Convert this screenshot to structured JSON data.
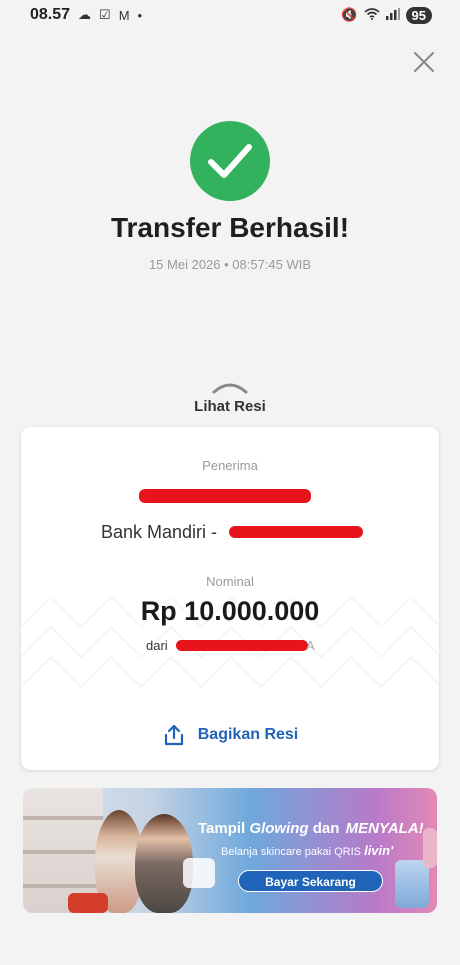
{
  "status_bar": {
    "time": "08.57",
    "battery": "95"
  },
  "result": {
    "title": "Transfer Berhasil!",
    "timestamp": "15 Mei 2026 • 08:57:45 WIB",
    "status_color": "#33b25d"
  },
  "receipt_toggle": {
    "label": "Lihat Resi"
  },
  "receipt": {
    "recipient_label": "Penerima",
    "bank_prefix": "Bank Mandiri - ",
    "amount_label": "Nominal",
    "amount": "Rp 10.000.000",
    "from_prefix": "dari",
    "from_suffix": "A",
    "redaction_color": "#e8141c"
  },
  "share": {
    "label": "Bagikan Resi",
    "color": "#1f64b8"
  },
  "promo": {
    "title_part1": "Tampil ",
    "title_italic": "Glowing",
    "title_part2": " dan ",
    "title_highlight": "MENYALA!",
    "subtitle": "Belanja skincare pakai QRIS",
    "brand": "livin'",
    "button": "Bayar Sekarang"
  }
}
